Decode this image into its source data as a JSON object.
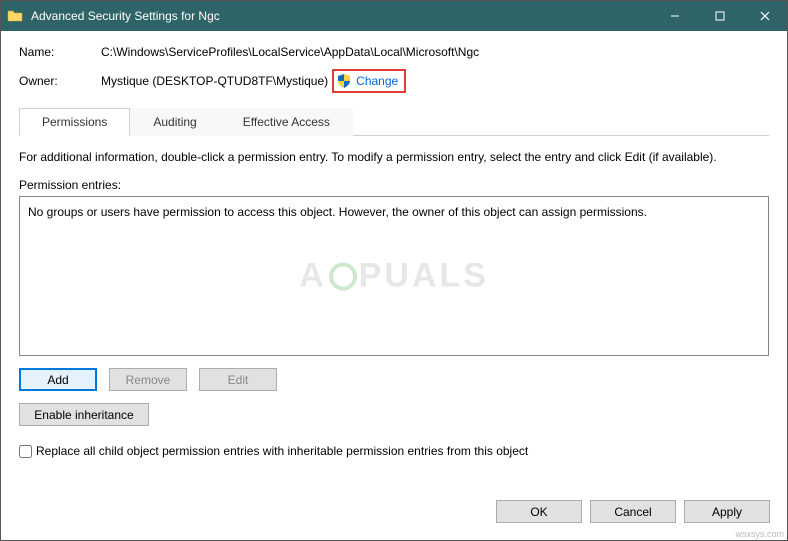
{
  "window": {
    "title": "Advanced Security Settings for Ngc"
  },
  "fields": {
    "name_label": "Name:",
    "name_value": "C:\\Windows\\ServiceProfiles\\LocalService\\AppData\\Local\\Microsoft\\Ngc",
    "owner_label": "Owner:",
    "owner_value": "Mystique (DESKTOP-QTUD8TF\\Mystique)",
    "change_link": "Change"
  },
  "tabs": {
    "permissions": "Permissions",
    "auditing": "Auditing",
    "effective": "Effective Access"
  },
  "info_text": "For additional information, double-click a permission entry. To modify a permission entry, select the entry and click Edit (if available).",
  "entries_label": "Permission entries:",
  "entries_message": "No groups or users have permission to access this object. However, the owner of this object can assign permissions.",
  "buttons": {
    "add": "Add",
    "remove": "Remove",
    "edit": "Edit",
    "enable_inheritance": "Enable inheritance",
    "ok": "OK",
    "cancel": "Cancel",
    "apply": "Apply"
  },
  "checkbox": {
    "replace_label": "Replace all child object permission entries with inheritable permission entries from this object"
  },
  "watermark_left": "A",
  "watermark_right": "PUALS",
  "corner": "wsxsys.com"
}
